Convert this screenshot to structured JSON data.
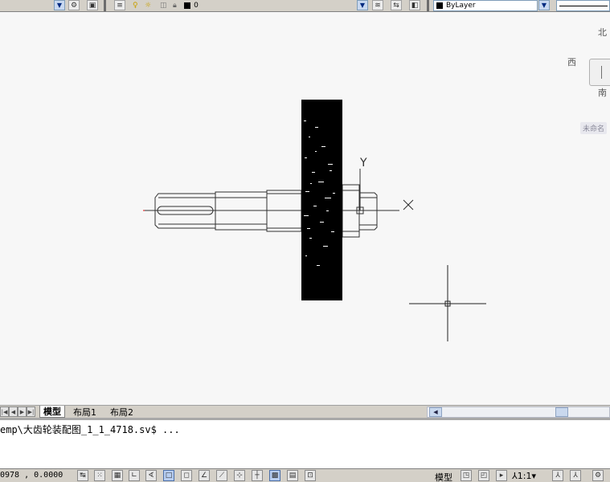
{
  "toolbar": {
    "layer_name": "0",
    "color_value": "ByLayer",
    "icons": [
      "workspace-settings-icon",
      "layer-properties-icon",
      "bulb-icon",
      "sun-icon",
      "lock-icon",
      "layer-color-icon",
      "match-layer-icon",
      "layer-previous-icon",
      "layer-state-icon"
    ]
  },
  "viewcube": {
    "north": "北",
    "west": "西",
    "south": "南",
    "ucs_name": "未命名"
  },
  "drawing": {
    "ucs_y_label": "Y"
  },
  "layout_tabs": [
    {
      "label": "模型",
      "active": true
    },
    {
      "label": "布局1",
      "active": false
    },
    {
      "label": "布局2",
      "active": false
    }
  ],
  "command_line": {
    "text": "emp\\大齿轮装配图_1_1_4718.sv$ ..."
  },
  "status_bar": {
    "coordinates": "0978 , 0.0000",
    "model_label": "模型",
    "annotation_scale": "1:1",
    "toggles": [
      "snap-icon",
      "grid-icon",
      "ortho-icon",
      "polar-icon",
      "osnap-icon",
      "otrack-icon",
      "ducs-icon",
      "dyn-icon",
      "lwt-icon",
      "tpy-icon",
      "qp-icon",
      "sc-icon"
    ]
  }
}
